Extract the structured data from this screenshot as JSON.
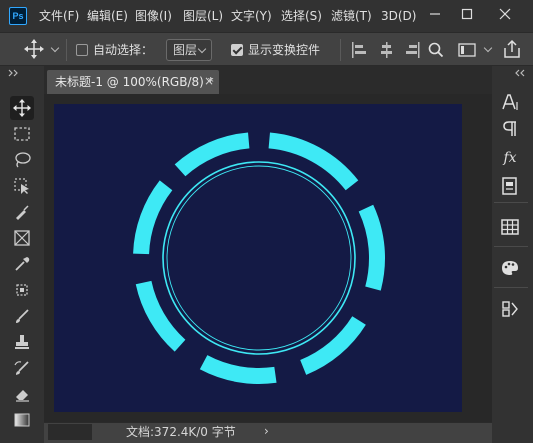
{
  "app": {
    "logo_text": "Ps"
  },
  "menu": [
    "文件(F)",
    "编辑(E)",
    "图像(I)",
    "图层(L)",
    "文字(Y)",
    "选择(S)",
    "滤镜(T)",
    "3D(D)"
  ],
  "options_bar": {
    "auto_select_label": "自动选择：",
    "auto_select_checked": false,
    "layer_dropdown_value": "图层",
    "show_transform_label": "显示变换控件",
    "show_transform_checked": true
  },
  "document_tab": {
    "title": "未标题-1 @ 100%(RGB/8) *",
    "close": "×"
  },
  "canvas": {
    "background": "#141a45",
    "ring_color": "#3ee9f5"
  },
  "status": {
    "text": "文档:372.4K/0 字节",
    "arrow": "›"
  },
  "right_panel": {
    "fx_label": "fx"
  },
  "colors": {
    "chrome_dark": "#323232",
    "options_bar": "#424242",
    "workspace": "#535353",
    "accent_blue": "#31a8ff"
  }
}
